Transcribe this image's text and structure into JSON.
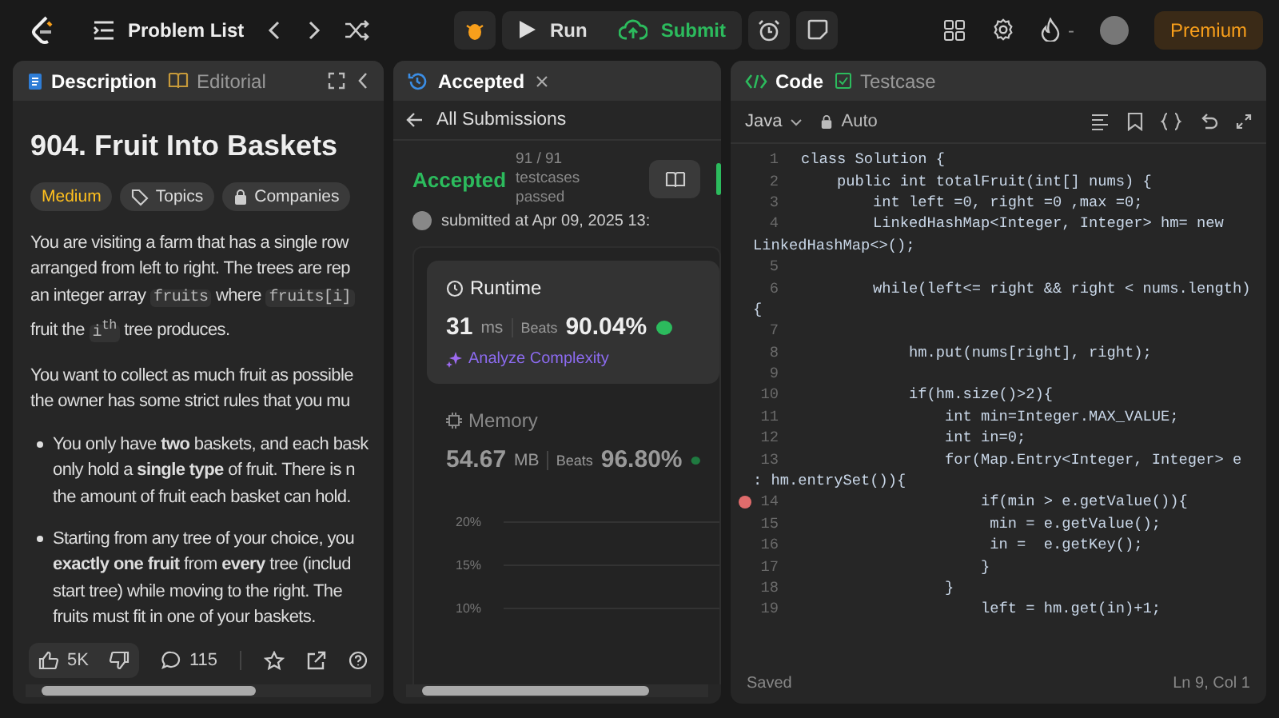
{
  "top_bar": {
    "problem_list": "Problem List",
    "run": "Run",
    "submit": "Submit",
    "streak": "-",
    "premium": "Premium"
  },
  "description_panel": {
    "tabs": [
      {
        "label": "Description",
        "selected": true
      },
      {
        "label": "Editorial",
        "selected": false
      }
    ],
    "title": "904. Fruit Into Baskets",
    "tags": [
      {
        "label": "Medium",
        "kind": "difficulty"
      },
      {
        "label": "Topics",
        "kind": "topics"
      },
      {
        "label": "Companies",
        "kind": "companies"
      }
    ],
    "paragraphs": [
      {
        "kind": "text",
        "lines": [
          [
            {
              "t": "You are visiting a farm that has a single row"
            }
          ],
          [
            {
              "t": "arranged from left to right. The trees are rep"
            }
          ],
          [
            {
              "t": "an integer array "
            },
            {
              "t": "fruits",
              "code": true
            },
            {
              "t": " where "
            },
            {
              "t": "fruits[i]",
              "code": true
            }
          ],
          [
            {
              "t": "fruit the "
            },
            {
              "t": "i$^{th}$",
              "code": true
            },
            {
              "t": " tree produces."
            }
          ]
        ]
      },
      {
        "kind": "text",
        "lines": [
          [
            {
              "t": "You want to collect as much fruit as possible"
            }
          ],
          [
            {
              "t": "the owner has some strict rules that you mu"
            }
          ]
        ]
      },
      {
        "kind": "bullet",
        "lines": [
          [
            {
              "t": "You only have **two** baskets, and each bask"
            }
          ],
          [
            {
              "t": "only hold a **single type** of fruit. There is n"
            }
          ],
          [
            {
              "t": "the amount of fruit each basket can hold."
            }
          ]
        ]
      },
      {
        "kind": "bullet",
        "lines": [
          [
            {
              "t": "Starting from any tree of your choice, you"
            }
          ],
          [
            {
              "t": "**exactly one fruit** from **every** tree (includ"
            }
          ],
          [
            {
              "t": "start tree) while moving to the right. The"
            }
          ],
          [
            {
              "t": "fruits must fit in one of your baskets."
            }
          ]
        ]
      }
    ],
    "likes": "5K",
    "comments": "115"
  },
  "submission_panel": {
    "tab": "Accepted",
    "back": "All Submissions",
    "status": "Accepted",
    "testcases": "91 / 91 testcases",
    "testcases_2": "passed",
    "submitted": "submitted at Apr 09, 2025 13:",
    "runtime": {
      "label": "Runtime",
      "value": "31",
      "unit": "ms",
      "beats": "Beats",
      "percent": "90.04%",
      "analyze": "Analyze Complexity"
    },
    "memory": {
      "label": "Memory",
      "value": "54.67",
      "unit": "MB",
      "beats": "Beats",
      "percent": "96.80%"
    },
    "chart_labels": [
      "20%",
      "15%",
      "10%"
    ]
  },
  "code_panel": {
    "tabs": [
      {
        "label": "Code",
        "selected": true
      },
      {
        "label": "Testcase",
        "selected": false
      }
    ],
    "language": "Java",
    "mode": "Auto",
    "lines": [
      {
        "number": "1",
        "text": "class Solution {",
        "breakpoint": false
      },
      {
        "number": "2",
        "text": "    public int totalFruit(int[] nums) {",
        "breakpoint": false
      },
      {
        "number": "3",
        "text": "        int left =0, right =0 ,max =0;",
        "breakpoint": false
      },
      {
        "number": "4",
        "text": "        LinkedHashMap<Integer, Integer> hm= new",
        "breakpoint": false
      },
      {
        "text": "LinkedHashMap<>();",
        "breakpoint": false
      },
      {
        "number": "5",
        "breakpoint": false
      },
      {
        "number": "6",
        "text": "        while(left<= right && right < nums.length)",
        "breakpoint": false
      },
      {
        "text": "{",
        "breakpoint": false
      },
      {
        "number": "7",
        "breakpoint": false
      },
      {
        "number": "8",
        "text": "            hm.put(nums[right], right);",
        "breakpoint": false
      },
      {
        "number": "9",
        "breakpoint": false
      },
      {
        "number": "10",
        "text": "            if(hm.size()>2){",
        "breakpoint": false
      },
      {
        "number": "11",
        "text": "                int min=Integer.MAX_VALUE;",
        "breakpoint": false
      },
      {
        "number": "12",
        "text": "                int in=0;",
        "breakpoint": false
      },
      {
        "number": "13",
        "text": "                for(Map.Entry<Integer, Integer> e",
        "breakpoint": false
      },
      {
        "text": ": hm.entrySet()){",
        "breakpoint": false
      },
      {
        "number": "14",
        "text": "                    if(min > e.getValue()){",
        "breakpoint": true
      },
      {
        "number": "15",
        "text": "                     min = e.getValue();",
        "breakpoint": false
      },
      {
        "number": "16",
        "text": "                     in =  e.getKey();",
        "breakpoint": false
      },
      {
        "number": "17",
        "text": "                    }",
        "breakpoint": false
      },
      {
        "number": "18",
        "text": "                }",
        "breakpoint": false
      },
      {
        "number": "19",
        "text": "                    left = hm.get(in)+1;",
        "breakpoint": false
      }
    ],
    "saved": "Saved",
    "cursor": "Ln 9, Col 1"
  }
}
